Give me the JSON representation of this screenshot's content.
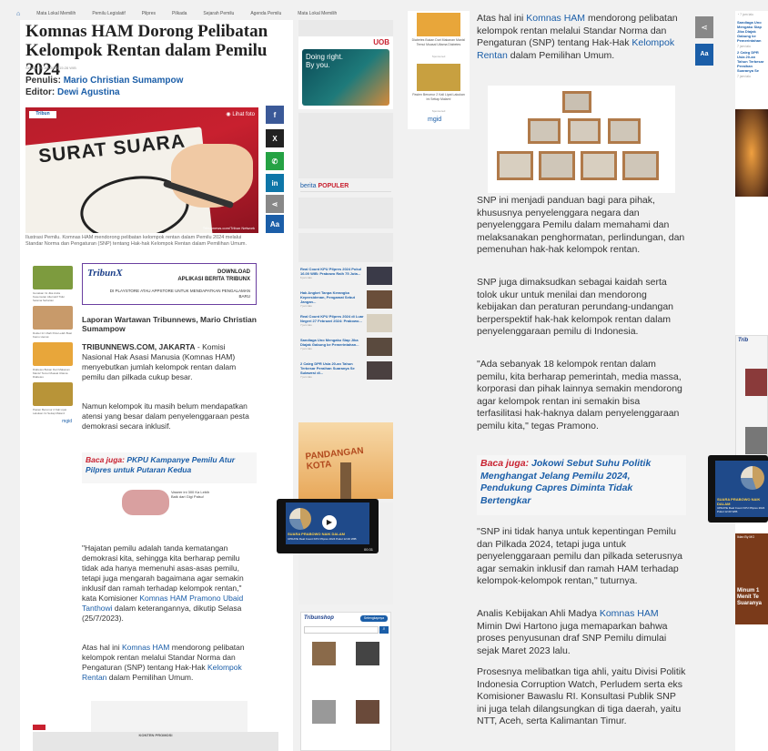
{
  "nav": [
    "Mata Lokal Memilih",
    "Pemilu Legislatif",
    "Pilpres",
    "Pilkada",
    "Sejarah Pemilu",
    "Agenda Pemilu",
    "Mata Lokal Memilih"
  ],
  "article": {
    "title": "Komnas HAM Dorong Pelibatan Kelompok Rentan dalam Pemilu 2024",
    "date": "Selasa, 25 Juli 2023 15:28 WIB",
    "writer_label": "Penulis:",
    "writer": "Mario Christian Sumampow",
    "editor_label": "Editor:",
    "editor": "Dewi Agustina",
    "hero_text": "SURAT SUARA",
    "hero_tag": "Lihat foto",
    "hero_credit": "Tribunnews.com/Tribun Network",
    "caption": "Ilustrasi Pemilu. Komnas HAM mendorong pelibatan kelompok rentan dalam Pemilu 2024 melalui Standar Norma dan Pengaturan (SNP) tentang Hak-hak Kelompok Rentan dalam Pemilihan Umum.",
    "download_brand": "TribunX",
    "download_title": "DOWNLOAD",
    "download_app": "APLIKASI BERITA TRIBUNX",
    "download_sub": "DI PLAYSTORE ATAU APPSTORE UNTUK MENDAPATKAN PENGALAMAN BARU",
    "reporter": "Laporan Wartawan Tribunnews, Mario Christian Sumampow",
    "p1_lead": "TRIBUNNEWS.COM, JAKARTA",
    "p1": " - Komisi Nasional Hak Asasi Manusia (Komnas HAM) menyebutkan jumlah kelompok rentan dalam pemilu dan pilkada cukup besar.",
    "p2": "Namun kelompok itu masih belum mendapatkan atensi yang besar dalam penyelenggaraan pesta demokrasi secara inklusif.",
    "baca1_label": "Baca juga:",
    "baca1": "PKPU Kampanye Pemilu Atur Pilpres untuk Putaran Kedua",
    "ad_small": "Vaseer ini 300 Ka Lebih Baik dari Gigi Palsu!",
    "p3a": "\"Hajatan pemilu adalah tanda kematangan demokrasi kita, sehingga kita berharap pemilu tidak ada hanya memenuhi asas-asas pemilu, tetapi juga mengarah bagaimana agar semakin inklusif dan ramah terhadap kelompok rentan,\" kata Komisioner ",
    "p3_link": "Komnas HAM Pramono Ubaid Tanthowi",
    "p3b": " dalam keterangannya, dikutip Selasa (25/7/2023).",
    "p4a": "Atas hal ini ",
    "p4_link1": "Komnas HAM",
    "p4b": " mendorong pelibatan kelompok rentan melalui Standar Norma dan Pengaturan (SNP) tentang Hak-Hak ",
    "p4_link2": "Kelompok Rentan",
    "p4c": " dalam Pemilihan Umum.",
    "promo": "KONTEN PROMOSI"
  },
  "right_article": {
    "p0a": "Atas hal ini ",
    "p0_link1": "Komnas HAM",
    "p0b": " mendorong pelibatan kelompok rentan melalui Standar Norma dan Pengaturan (SNP) tentang Hak-Hak ",
    "p0_link2": "Kelompok Rentan",
    "p0c": " dalam Pemilihan Umum.",
    "p1": "SNP ini menjadi panduan bagi para pihak, khususnya penyelenggara negara dan penyelenggara Pemilu dalam memahami dan melaksanakan penghormatan, perlindungan, dan pemenuhan hak-hak kelompok rentan.",
    "p2": "SNP juga dimaksudkan sebagai kaidah serta tolok ukur untuk menilai dan mendorong kebijakan dan peraturan perundang-undangan berperspektif hak-hak kelompok rentan dalam penyelenggaraan pemilu di Indonesia.",
    "p3": "\"Ada sebanyak 18 kelompok rentan dalam pemilu, kita berharap pemerintah, media massa, korporasi dan pihak lainnya semakin mendorong agar kelompok rentan ini semakin bisa terfasilitasi hak-haknya dalam penyelenggaraan pemilu kita,\" tegas Pramono.",
    "baca_label": "Baca juga:",
    "baca": "Jokowi Sebut Suhu Politik Menghangat Jelang Pemilu 2024, Pendukung Capres Diminta Tidak Bertengkar",
    "p4": "\"SNP ini tidak hanya untuk kepentingan Pemilu dan Pilkada 2024, tetapi juga untuk penyelenggaraan pemilu dan pilkada seterusnya agar semakin inklusif dan ramah HAM terhadap kelompok-kelompok rentan,\" tuturnya.",
    "p5a": "Analis Kebijakan Ahli Madya ",
    "p5_link": "Komnas HAM",
    "p5b": " Mimin Dwi Hartono juga memaparkan bahwa proses penyusunan draf SNP Pemilu dimulai sejak Maret 2023 lalu.",
    "p6": "Prosesnya melibatkan tiga ahli, yaitu Divisi Politik Indonesia Corruption Watch, Perludem serta eks Komisioner Bawaslu RI. Konsultasi Publik SNP ini juga telah dilangsungkan di tiga daerah, yaitu NTT, Aceh, serta Kalimantan Timur."
  },
  "sidebar": {
    "uob_brand": "UOB",
    "uob_text": "Doing right. By you.",
    "popular_prefix": "berita",
    "popular_label": "POPULER",
    "popular": [
      {
        "title": "Real Count KPU Pilpres 2024 Pukul 16.00 WIB: Prabowo Raih 75 Juta...",
        "time": "6 jam lalu"
      },
      {
        "title": "Hak Angket Tanpa Kerangka Kepresidenan, Pengamat Sebut Jangan...",
        "time": "7 jam lalu"
      },
      {
        "title": "Real Count KPU Pilpres 2024 di Luar Negeri 27 Februari 2024: Prabowo...",
        "time": "7 jam lalu"
      },
      {
        "title": "Sandiaga Uno Mengaku Siap Jika Diajak Gabung ke Pemerintahan...",
        "time": "7 jam lalu"
      },
      {
        "title": "2 Caleg DPR Usia 20-an Tahun Terbesar Peraihan Suaranya Se Sulawesi di...",
        "time": "7 jam lalu"
      }
    ],
    "ad_mid": "PANDANGAN KOTA",
    "top_ads": [
      {
        "title": "Diabetes Bukan Dari Makanan Manis! Temui Muasal Ultama Diabetes",
        "src": "Sponsored"
      },
      {
        "title": "Pasien Berumur 2 Kali Lipat Lakukan Ini Setiap Malam!",
        "src": "Sponsored"
      }
    ],
    "mgid": "mgid",
    "store_title": "Tribunshop",
    "store_btn": "Selengkapnya"
  },
  "left_ads": [
    {
      "t": "Gunakan Ini Jika Anda Kesemutan Alternatif Tidur Selama Seharian"
    },
    {
      "t": "Dokter Ini Ubah Pola Lelah Buat Kamu Hemat"
    },
    {
      "t": "Diabetes Bukan Dari Makanan Manis! Temui Muasal Ultama Diabetes"
    },
    {
      "t": "Pasien Berumur 2 Kali Lipat Lakukan Ini Setiap Malam!"
    }
  ],
  "far_right": {
    "items": [
      {
        "title": "Sandiaga Uno Mengaku Siap Jika Diajak Gabung ke Pemerintahan",
        "time": "7 jam lalu"
      },
      {
        "title": "2 Caleg DPR Usia 20-an Tahun Terbesar Peraihan Suaranya Se",
        "time": "7 jam lalu"
      }
    ],
    "ad_text": "Minum 1 Menit Te Suaranya",
    "ad_label": "Iklan By MG"
  },
  "video": {
    "title": "SUARA PRABOWO NAIK DALAM",
    "sub": "UPDATE Real Count KPU Pilpres 2024 Pukul 12.00 WIB",
    "time": "00:31"
  },
  "share": [
    "f",
    "X",
    "W",
    "in",
    "share",
    "Aa"
  ],
  "colors": {
    "link": "#1b5ea8",
    "red": "#c8202f",
    "facebook": "#3b5998",
    "twitter": "#222",
    "whatsapp": "#25a244",
    "linkedin": "#0e76a8",
    "share": "#888",
    "font": "#1b5ea8"
  }
}
